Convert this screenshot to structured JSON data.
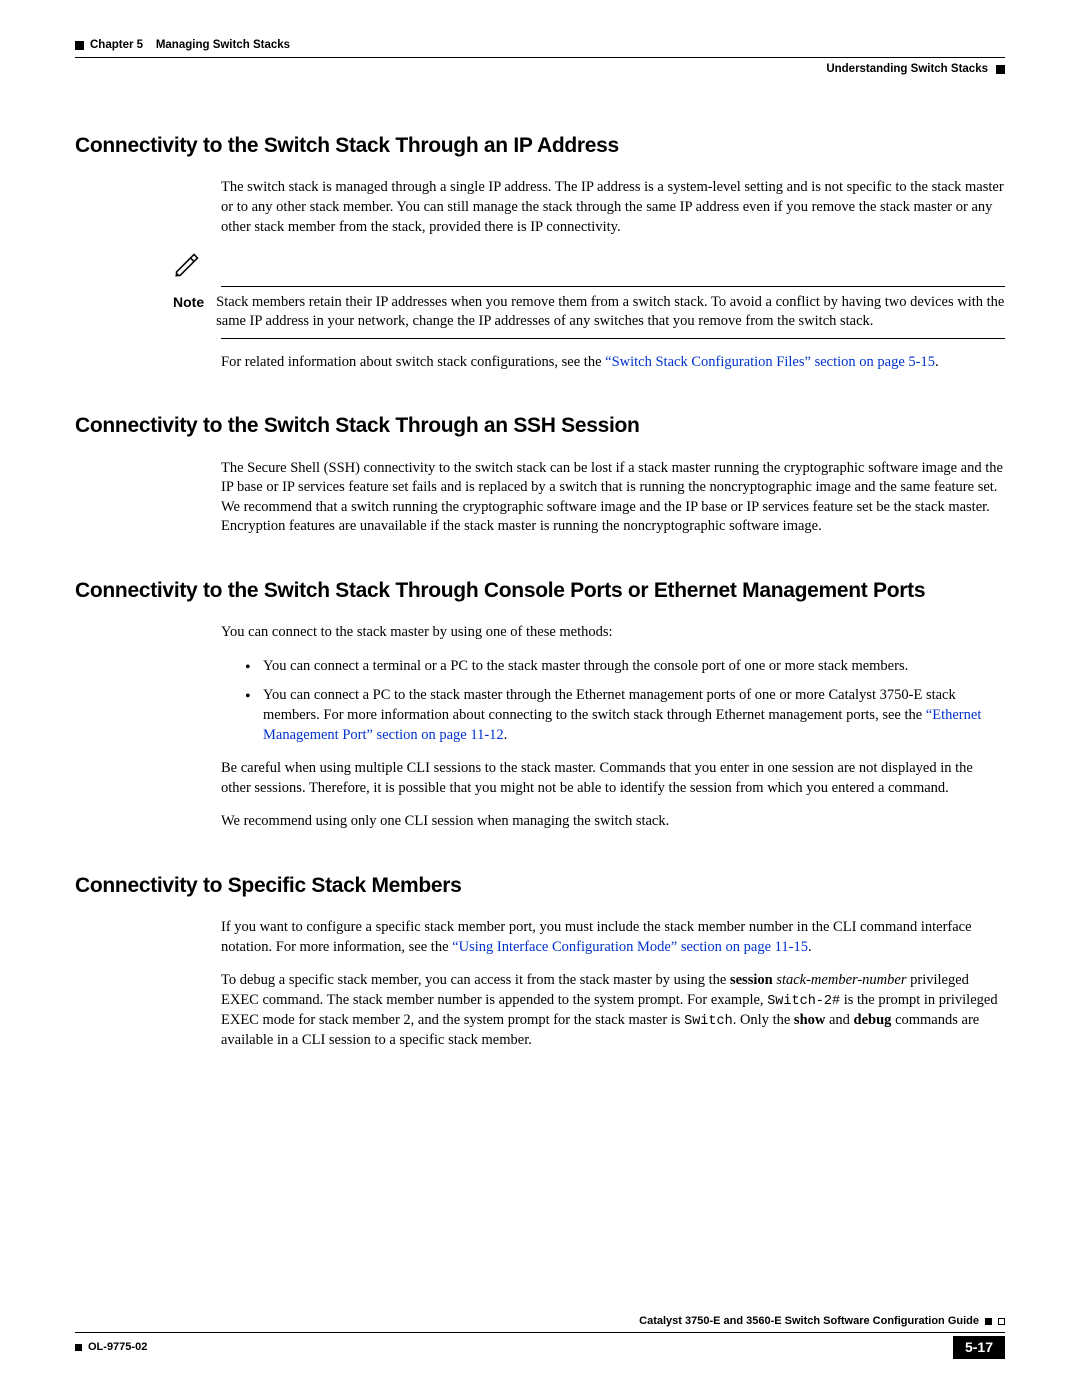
{
  "header": {
    "chapter": "Chapter 5",
    "title": "Managing Switch Stacks",
    "subtitle": "Understanding Switch Stacks"
  },
  "sections": {
    "ip": {
      "heading": "Connectivity to the Switch Stack Through an IP Address",
      "p1": "The switch stack is managed through a single IP address. The IP address is a system-level setting and is not specific to the stack master or to any other stack member. You can still manage the stack through the same IP address even if you remove the stack master or any other stack member from the stack, provided there is IP connectivity.",
      "note_label": "Note",
      "note": "Stack members retain their IP addresses when you remove them from a switch stack. To avoid a conflict by having two devices with the same IP address in your network, change the IP addresses of any switches that you remove from the switch stack.",
      "p2_pre": "For related information about switch stack configurations, see the ",
      "p2_link": "“Switch Stack Configuration Files” section on page 5-15",
      "p2_post": "."
    },
    "ssh": {
      "heading": "Connectivity to the Switch Stack Through an SSH Session",
      "p1": "The Secure Shell (SSH) connectivity to the switch stack can be lost if a stack master running the cryptographic software image and the IP base or IP services feature set fails and is replaced by a switch that is running the noncryptographic image and the same feature set. We recommend that a switch running the cryptographic software image and the IP base or IP services feature set be the stack master. Encryption features are unavailable if the stack master is running the noncryptographic software image."
    },
    "console": {
      "heading": "Connectivity to the Switch Stack Through Console Ports or Ethernet Management Ports",
      "p1": "You can connect to the stack master by using one of these methods:",
      "b1": "You can connect a terminal or a PC to the stack master through the console port of one or more stack members.",
      "b2_pre": "You can connect a PC to the stack master through the Ethernet management ports of one or more Catalyst 3750-E stack members. For more information about connecting to the switch stack through Ethernet management ports, see the ",
      "b2_link": "“Ethernet Management Port” section on page 11-12",
      "b2_post": ".",
      "p2": "Be careful when using multiple CLI sessions to the stack master. Commands that you enter in one session are not displayed in the other sessions. Therefore, it is possible that you might not be able to identify the session from which you entered a command.",
      "p3": "We recommend using only one CLI session when managing the switch stack."
    },
    "specific": {
      "heading": "Connectivity to Specific Stack Members",
      "p1_pre": "If you want to configure a specific stack member port, you must include the stack member number in the CLI command interface notation. For more information, see the ",
      "p1_link": "“Using Interface Configuration Mode” section on page 11-15",
      "p1_post": ".",
      "p2_a": "To debug a specific stack member, you can access it from the stack master by using the ",
      "p2_b": "session",
      "p2_c": " ",
      "p2_d": "stack-member-number",
      "p2_e": " privileged EXEC command. The stack member number is appended to the system prompt. For example, ",
      "p2_f": "Switch-2#",
      "p2_g": " is the prompt in privileged EXEC mode for stack member 2, and the system prompt for the stack master is ",
      "p2_h": "Switch",
      "p2_i": ". Only the ",
      "p2_j": "show",
      "p2_k": " and ",
      "p2_l": "debug",
      "p2_m": " commands are available in a CLI session to a specific stack member."
    }
  },
  "footer": {
    "guide": "Catalyst 3750-E and 3560-E Switch Software Configuration Guide",
    "doc": "OL-9775-02",
    "page": "5-17"
  }
}
